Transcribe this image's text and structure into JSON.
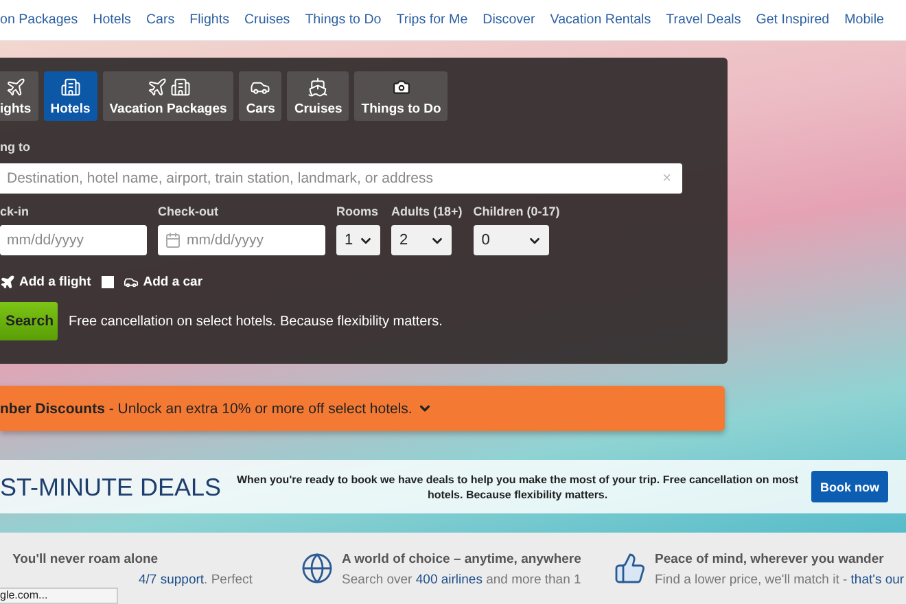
{
  "nav": {
    "links": [
      "on Packages",
      "Hotels",
      "Cars",
      "Flights",
      "Cruises",
      "Things to Do",
      "Trips for Me",
      "Discover",
      "Vacation Rentals",
      "Travel Deals",
      "Get Inspired",
      "Mobile"
    ]
  },
  "search_panel": {
    "tabs": [
      {
        "label": "ights",
        "kind": "flight",
        "selected": false
      },
      {
        "label": "Hotels",
        "kind": "hotel",
        "selected": true
      },
      {
        "label": "Vacation Packages",
        "kind": "package",
        "selected": false
      },
      {
        "label": "Cars",
        "kind": "car",
        "selected": false
      },
      {
        "label": "Cruises",
        "kind": "cruise",
        "selected": false
      },
      {
        "label": "Things to Do",
        "kind": "activity",
        "selected": false
      }
    ],
    "destination": {
      "label": "ng to",
      "placeholder": "Destination, hotel name, airport, train station, landmark, or address",
      "clear": "×"
    },
    "check_in": {
      "label": "ck-in",
      "placeholder": "mm/dd/yyyy"
    },
    "check_out": {
      "label": "Check-out",
      "placeholder": "mm/dd/yyyy"
    },
    "selects": [
      {
        "label": "Rooms",
        "value": "1"
      },
      {
        "label": "Adults (18+)",
        "value": "2"
      },
      {
        "label": "Children (0-17)",
        "value": "0"
      }
    ],
    "add_ons": [
      {
        "label": "Add a flight",
        "kind": "flight"
      },
      {
        "label": "Add a car",
        "kind": "car",
        "checked": false
      }
    ],
    "search_button": "Search",
    "note": "Free cancellation on select hotels. Because flexibility matters."
  },
  "member_banner": {
    "text": "**nber Discounts** - Unlock an extra 10% or more off select hotels."
  },
  "deals": {
    "heading": "ST-MINUTE DEALS",
    "text": "When you're ready to book we have deals to help you make the most of your trip. Free cancellation on most hotels. Because flexibility matters.",
    "button": "Book now"
  },
  "features": [
    {
      "kind": "plain",
      "title": "You'll never roam alone",
      "parts": [
        {
          "text": "4/7 support",
          "kind": "link"
        },
        {
          "text": ". Perfect",
          "kind": "text"
        }
      ]
    },
    {
      "kind": "globe",
      "title": "A world of choice – anytime, anywhere",
      "parts": [
        {
          "text": "Search over ",
          "kind": "text"
        },
        {
          "text": "400 airlines",
          "kind": "link"
        },
        {
          "text": " and more than 1",
          "kind": "text"
        }
      ]
    },
    {
      "kind": "thumb",
      "title": "Peace of mind, wherever you wander",
      "parts": [
        {
          "text": "Find a lower price, we'll match it - ",
          "kind": "text"
        },
        {
          "text": "that's our",
          "kind": "link"
        }
      ]
    }
  ],
  "status_tooltip": "gle.com..."
}
